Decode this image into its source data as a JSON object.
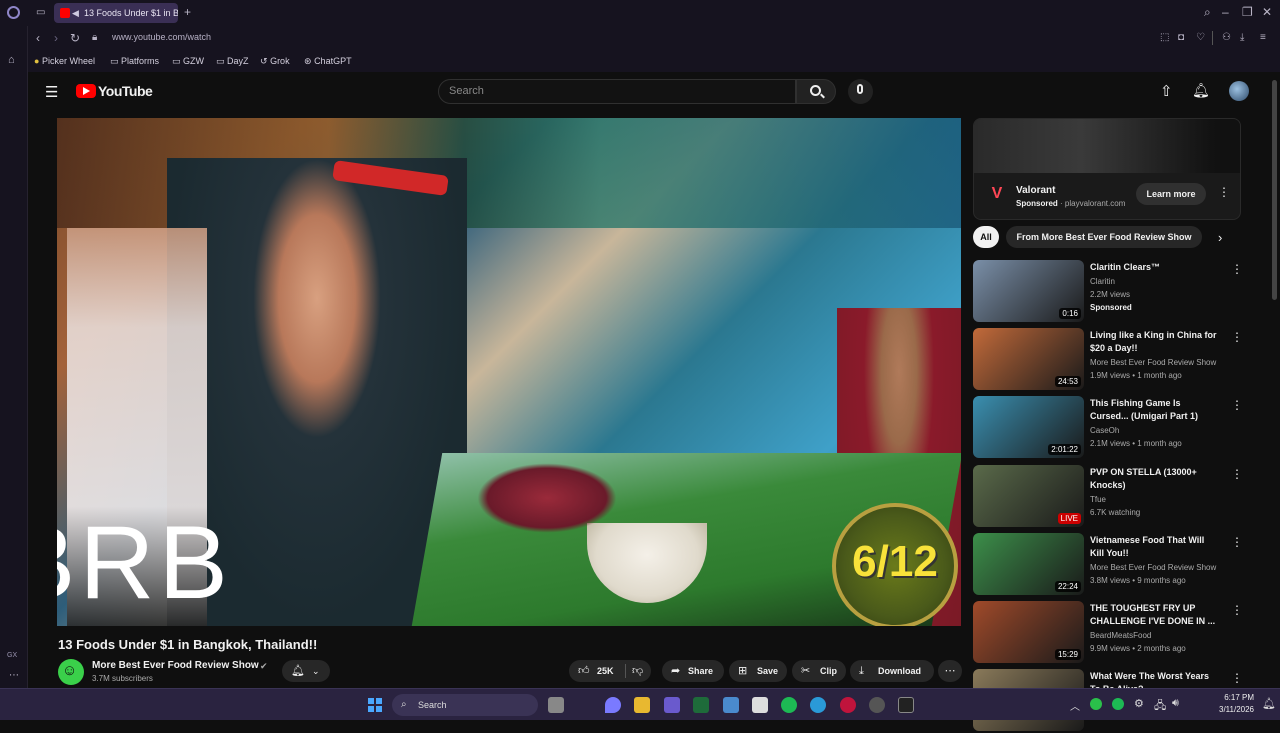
{
  "browser": {
    "tab_title": "13 Foods Under $1 in B",
    "url": "www.youtube.com/watch",
    "bookmarks": [
      "Picker Wheel",
      "Platforms",
      "GZW",
      "DayZ",
      "Grok",
      "ChatGPT"
    ],
    "sidebar_labels": [
      "GX"
    ]
  },
  "youtube": {
    "logo": "YouTube",
    "search_placeholder": "Search",
    "video": {
      "title": "13 Foods Under $1 in Bangkok, Thailand!!",
      "overlay_text": "BRB",
      "counter": "6/12",
      "channel": "More Best Ever Food Review Show",
      "subscribers": "3.7M subscribers",
      "likes": "25K",
      "actions": [
        "Share",
        "Save",
        "Clip",
        "Download"
      ]
    },
    "ad": {
      "name": "Valorant",
      "sponsored": "Sponsored",
      "domain": "playvalorant.com",
      "cta": "Learn more",
      "logo_text": "V"
    },
    "chips": [
      "All",
      "From More Best Ever Food Review Show"
    ],
    "recommendations": [
      {
        "title": "Claritin Clears™",
        "channel": "Claritin",
        "meta": "2.2M views",
        "extra": "Sponsored",
        "duration": "0:16",
        "thumb_color": "#7a8fa8"
      },
      {
        "title": "Living like a King in China for $20 a Day!!",
        "channel": "More Best Ever Food Review Show",
        "meta": "1.9M views • 1 month ago",
        "extra": "",
        "duration": "24:53",
        "thumb_color": "#c26a3a"
      },
      {
        "title": "This Fishing Game Is Cursed... (Umigari Part 1)",
        "channel": "CaseOh",
        "meta": "2.1M views • 1 month ago",
        "extra": "",
        "duration": "2:01:22",
        "thumb_color": "#3a8fb0"
      },
      {
        "title": "PVP ON STELLA (13000+ Knocks)",
        "channel": "Tfue",
        "meta": "6.7K watching",
        "extra": "",
        "duration": "LIVE",
        "thumb_color": "#5a6a4a"
      },
      {
        "title": "Vietnamese Food That Will Kill You!!",
        "channel": "More Best Ever Food Review Show",
        "meta": "3.8M views • 9 months ago",
        "extra": "",
        "duration": "22:24",
        "thumb_color": "#3c8f4a"
      },
      {
        "title": "THE TOUGHEST FRY UP CHALLENGE I'VE DONE IN ...",
        "channel": "BeardMeatsFood",
        "meta": "9.9M views • 2 months ago",
        "extra": "",
        "duration": "15:29",
        "thumb_color": "#a04a2a"
      },
      {
        "title": "What Were The Worst Years To Be Alive?",
        "channel": "",
        "meta": "",
        "extra": "",
        "duration": "",
        "thumb_color": "#8a7a5a"
      }
    ]
  },
  "taskbar": {
    "search": "Search",
    "time": "6:17 PM",
    "date": "3/11/2026"
  }
}
